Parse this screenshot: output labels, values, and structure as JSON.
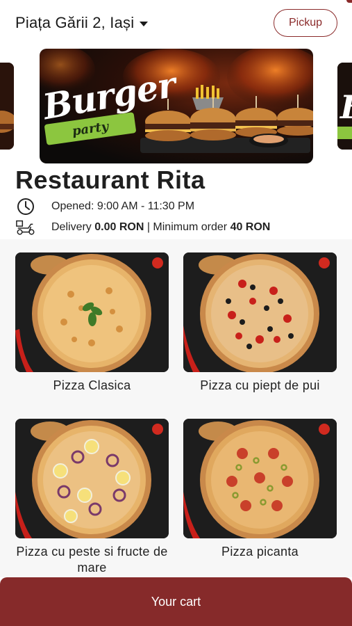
{
  "header": {
    "location": "Piața Gării 2, Iași",
    "pickup_label": "Pickup"
  },
  "banner": {
    "word_main": "Burger",
    "word_sub": "party",
    "colors": {
      "accent": "#8cc63f"
    }
  },
  "restaurant": {
    "name": "Restaurant Rita",
    "hours": "Opened: 9:00 AM - 11:30 PM",
    "delivery_prefix": "Delivery ",
    "delivery_fee": "0.00 RON",
    "separator": " | Minimum order ",
    "min_order": "40 RON"
  },
  "menu": {
    "items": [
      {
        "name": "Pizza Clasica"
      },
      {
        "name": "Pizza cu piept de pui"
      },
      {
        "name": "Pizza cu peste si fructe de mare"
      },
      {
        "name": "Pizza picanta"
      }
    ]
  },
  "cart": {
    "label": "Your cart"
  },
  "icons": {
    "location_caret": "chevron-down-icon",
    "hours": "clock-icon",
    "delivery": "scooter-icon"
  },
  "colors": {
    "brand": "#862a2a",
    "background": "#ffffff",
    "menu_background": "#f7f7f7"
  }
}
